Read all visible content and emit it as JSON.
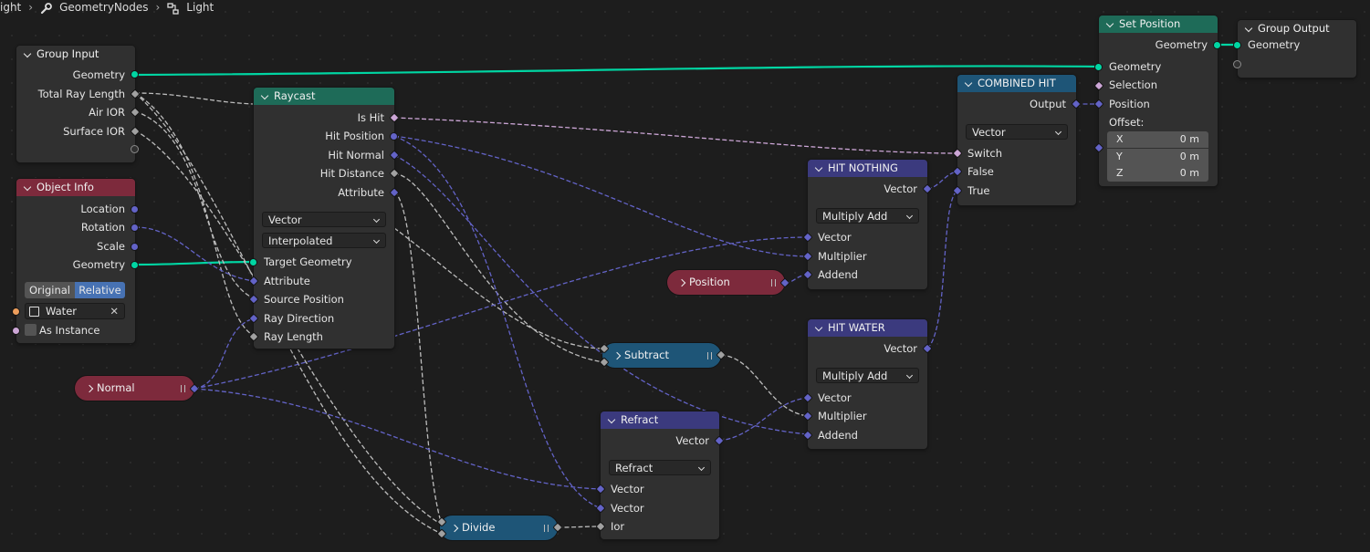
{
  "breadcrumb": [
    "ight",
    "GeometryNodes",
    "Light"
  ],
  "colors": {
    "geometry": "#00d6a3",
    "vector": "#6363c7",
    "float": "#a1a1a1",
    "boolean": "#cca6d6",
    "teal_header": "#1e6b58",
    "red_header": "#7d2a3c",
    "blue_header": "#1e5577",
    "purple_header": "#3b3a7e"
  },
  "nodes": {
    "group_input": {
      "title": "Group Input",
      "outputs": [
        "Geometry",
        "Total Ray Length",
        "Air IOR",
        "Surface IOR"
      ]
    },
    "object_info": {
      "title": "Object Info",
      "outputs": [
        "Location",
        "Rotation",
        "Scale",
        "Geometry"
      ],
      "mode_options": [
        "Original",
        "Relative"
      ],
      "mode_selected": "Relative",
      "object": "Water",
      "as_instance": "As Instance"
    },
    "raycast": {
      "title": "Raycast",
      "outputs": [
        "Is Hit",
        "Hit Position",
        "Hit Normal",
        "Hit Distance",
        "Attribute"
      ],
      "data_type": "Vector",
      "mapping": "Interpolated",
      "inputs": [
        "Target Geometry",
        "Attribute",
        "Source Position",
        "Ray Direction",
        "Ray Length"
      ]
    },
    "normal": {
      "title": "Normal"
    },
    "position": {
      "title": "Position"
    },
    "subtract": {
      "title": "Subtract"
    },
    "divide": {
      "title": "Divide"
    },
    "refract": {
      "title": "Refract",
      "output": "Vector",
      "operation": "Refract",
      "inputs": [
        "Vector",
        "Vector",
        "Ior"
      ]
    },
    "hit_nothing": {
      "title": "HIT NOTHING",
      "output": "Vector",
      "operation": "Multiply Add",
      "inputs": [
        "Vector",
        "Multiplier",
        "Addend"
      ]
    },
    "hit_water": {
      "title": "HIT WATER",
      "output": "Vector",
      "operation": "Multiply Add",
      "inputs": [
        "Vector",
        "Multiplier",
        "Addend"
      ]
    },
    "combined_hit": {
      "title": "COMBINED HIT",
      "output": "Output",
      "data_type": "Vector",
      "inputs": [
        "Switch",
        "False",
        "True"
      ]
    },
    "set_position": {
      "title": "Set Position",
      "output": "Geometry",
      "inputs": [
        "Geometry",
        "Selection",
        "Position"
      ],
      "offset_label": "Offset:",
      "offset": [
        {
          "axis": "X",
          "value": "0 m"
        },
        {
          "axis": "Y",
          "value": "0 m"
        },
        {
          "axis": "Z",
          "value": "0 m"
        }
      ]
    },
    "group_output": {
      "title": "Group Output",
      "inputs": [
        "Geometry"
      ]
    }
  }
}
